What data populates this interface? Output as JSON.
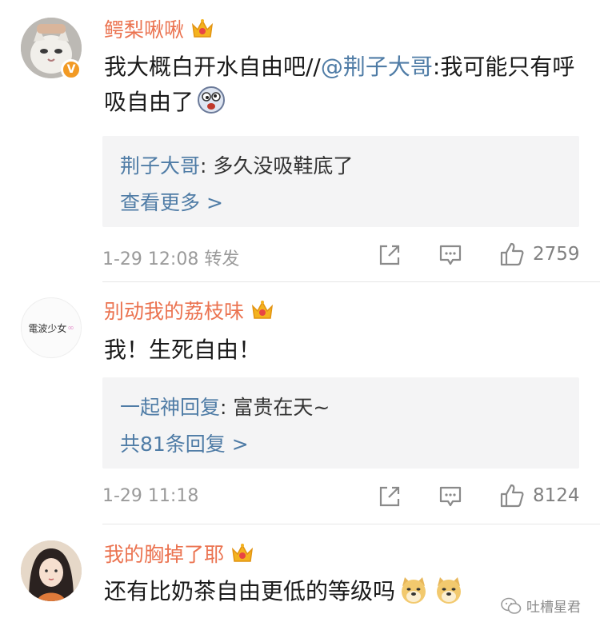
{
  "comments": [
    {
      "username": "鳄梨啾啾",
      "text_before": "我大概白开水自由吧//",
      "mention": "@荆子大哥",
      "text_after": ":我可能只有呼吸自由了",
      "quote_user": "荆子大哥",
      "quote_sep": ": ",
      "quote_text": "多久没吸鞋底了",
      "quote_more": "查看更多 >",
      "time": "1-29 12:08 转发",
      "likes": "2759"
    },
    {
      "username": "别动我的荔枝味",
      "avatar_text": "電波少女",
      "text": "我！生死自由！",
      "quote_user": "一起神回复",
      "quote_sep": ": ",
      "quote_text": "富贵在天~",
      "quote_more": "共81条回复 >",
      "time": "1-29 11:18",
      "likes": "8124"
    },
    {
      "username": "我的胸掉了耶",
      "text": "还有比奶茶自由更低的等级吗"
    }
  ],
  "watermark": "吐槽星君",
  "colors": {
    "username": "#eb7350",
    "link": "#4f7ca6",
    "meta": "#9a9a9a",
    "quote_bg": "#f4f4f5"
  }
}
